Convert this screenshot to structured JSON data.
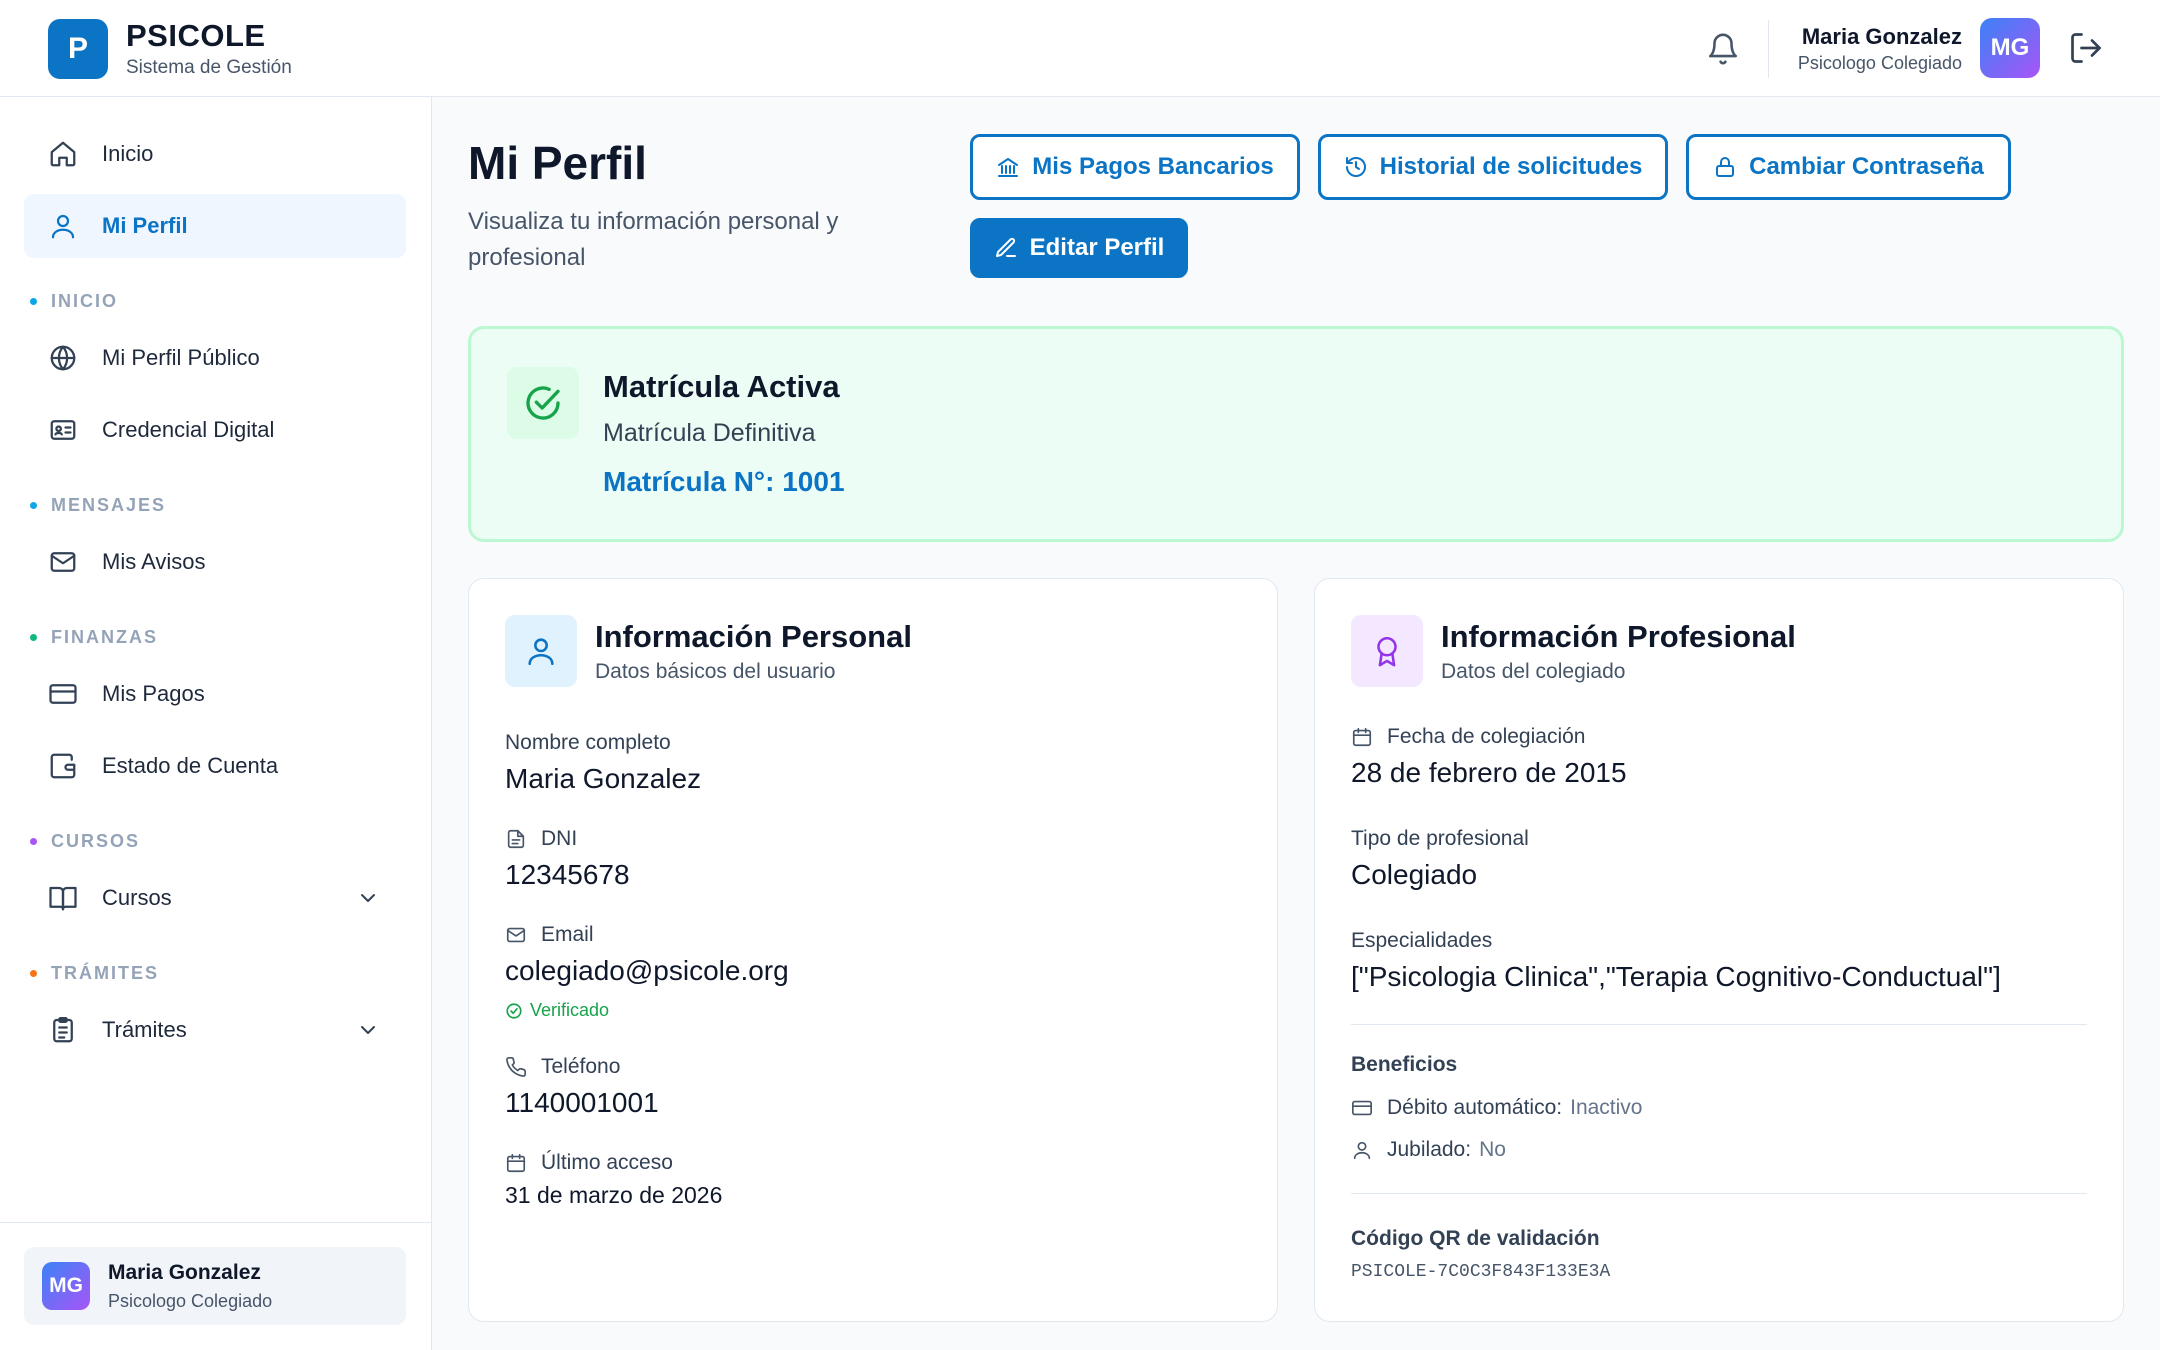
{
  "app": {
    "logo_letter": "P",
    "name": "PSICOLE",
    "subtitle": "Sistema de Gestión"
  },
  "header": {
    "user_name": "Maria Gonzalez",
    "user_role": "Psicologo Colegiado",
    "avatar_initials": "MG",
    "icons": [
      "bell-icon",
      "logout-icon"
    ]
  },
  "sidebar": {
    "top_items": [
      {
        "label": "Inicio",
        "icon": "home-icon"
      },
      {
        "label": "Mi Perfil",
        "icon": "user-icon",
        "active": true
      }
    ],
    "sections": [
      {
        "title": "INICIO",
        "dot_color": "#0ea5e9",
        "items": [
          {
            "label": "Mi Perfil Público",
            "icon": "globe-icon"
          },
          {
            "label": "Credencial Digital",
            "icon": "id-card-icon"
          }
        ]
      },
      {
        "title": "MENSAJES",
        "dot_color": "#0ea5e9",
        "items": [
          {
            "label": "Mis Avisos",
            "icon": "mail-icon"
          }
        ]
      },
      {
        "title": "FINANZAS",
        "dot_color": "#10b981",
        "items": [
          {
            "label": "Mis Pagos",
            "icon": "credit-card-icon"
          },
          {
            "label": "Estado de Cuenta",
            "icon": "wallet-icon"
          }
        ]
      },
      {
        "title": "CURSOS",
        "dot_color": "#a855f7",
        "items": [
          {
            "label": "Cursos",
            "icon": "book-icon",
            "expandable": true
          }
        ]
      },
      {
        "title": "TRÁMITES",
        "dot_color": "#f97316",
        "items": [
          {
            "label": "Trámites",
            "icon": "clipboard-icon",
            "expandable": true
          }
        ]
      }
    ],
    "footer_user": {
      "initials": "MG",
      "name": "Maria Gonzalez",
      "role": "Psicologo Colegiado"
    }
  },
  "page": {
    "title": "Mi Perfil",
    "subtitle": "Visualiza tu información personal y profesional",
    "buttons": {
      "bank_payments": "Mis Pagos Bancarios",
      "request_history": "Historial de solicitudes",
      "change_password": "Cambiar Contraseña",
      "edit_profile": "Editar Perfil"
    }
  },
  "status": {
    "title": "Matrícula Activa",
    "type": "Matrícula Definitiva",
    "number_text": "Matrícula N°: 1001"
  },
  "personal": {
    "title": "Información Personal",
    "subtitle": "Datos básicos del usuario",
    "full_name_label": "Nombre completo",
    "full_name": "Maria Gonzalez",
    "dni_label": "DNI",
    "dni": "12345678",
    "email_label": "Email",
    "email": "colegiado@psicole.org",
    "email_status": "Verificado",
    "phone_label": "Teléfono",
    "phone": "1140001001",
    "last_access_label": "Último acceso",
    "last_access": "31 de marzo de 2026"
  },
  "professional": {
    "title": "Información Profesional",
    "subtitle": "Datos del colegiado",
    "registration_date_label": "Fecha de colegiación",
    "registration_date": "28 de febrero de 2015",
    "type_label": "Tipo de profesional",
    "type": "Colegiado",
    "specialties_label": "Especialidades",
    "specialties": "[\"Psicologia Clinica\",\"Terapia Cognitivo-Conductual\"]",
    "benefits_title": "Beneficios",
    "auto_debit_label": "Débito automático:",
    "auto_debit_value": "Inactivo",
    "retired_label": "Jubilado:",
    "retired_value": "No",
    "qr_label": "Código QR de validación",
    "qr_code": "PSICOLE-7C0C3F843F133E3A"
  },
  "colors": {
    "primary": "#0b74c4",
    "success": "#16a34a",
    "accent_purple": "#9333ea"
  }
}
